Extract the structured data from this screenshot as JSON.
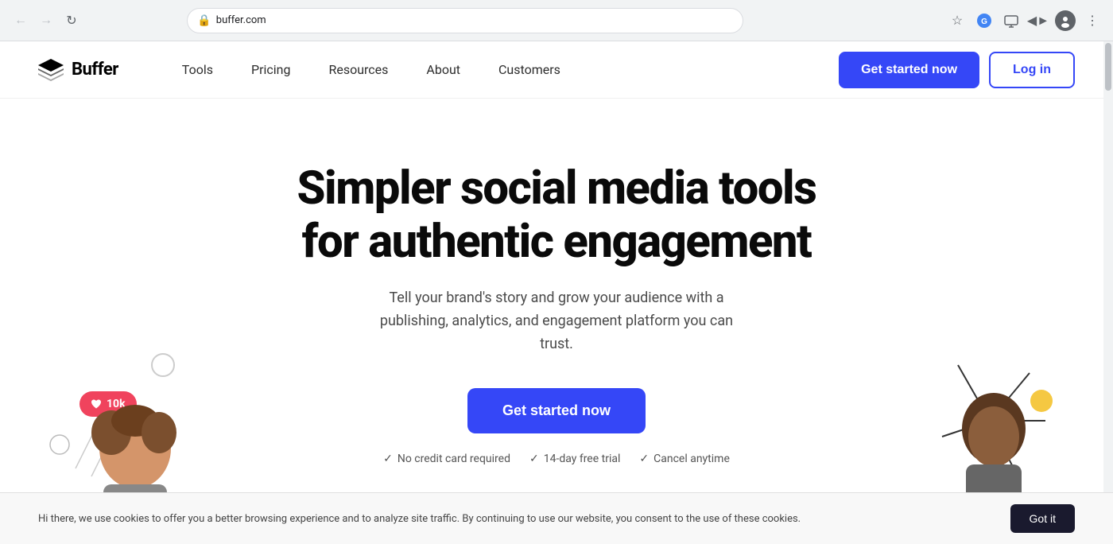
{
  "browser": {
    "url": "buffer.com",
    "back_disabled": false,
    "forward_disabled": true
  },
  "navbar": {
    "brand": "Buffer",
    "nav_items": [
      {
        "label": "Tools",
        "id": "tools"
      },
      {
        "label": "Pricing",
        "id": "pricing"
      },
      {
        "label": "Resources",
        "id": "resources"
      },
      {
        "label": "About",
        "id": "about"
      },
      {
        "label": "Customers",
        "id": "customers"
      }
    ],
    "cta_label": "Get started now",
    "login_label": "Log in"
  },
  "hero": {
    "title_line1": "Simpler social media tools",
    "title_line2": "for authentic engagement",
    "subtitle": "Tell your brand's story and grow your audience with a publishing, analytics, and engagement platform you can trust.",
    "cta_label": "Get started now",
    "trust_badges": [
      {
        "label": "No credit card required"
      },
      {
        "label": "14-day free trial"
      },
      {
        "label": "Cancel anytime"
      }
    ]
  },
  "like_badge": {
    "count": "10k"
  },
  "cookie_banner": {
    "text": "Hi there, we use cookies to offer you a better browsing experience and to analyze site traffic. By continuing to use our website, you consent to the use of these cookies.",
    "button_label": "Got it"
  },
  "colors": {
    "primary": "#3547F7",
    "like_red": "#f0435d",
    "yellow_dot": "#f5c842"
  }
}
